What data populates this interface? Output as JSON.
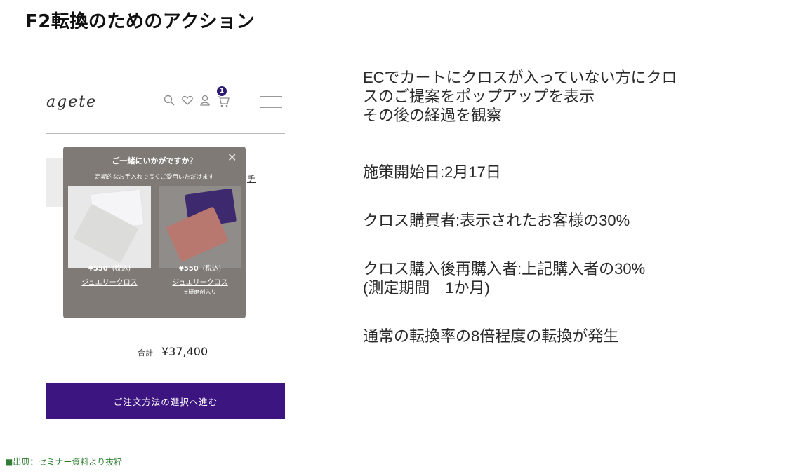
{
  "slide": {
    "title": "F2転換のためのアクション",
    "source": "■出典：セミナー資料より抜粋"
  },
  "site": {
    "logo": "agete",
    "cart_count": "1",
    "icons": [
      "search-icon",
      "heart-icon",
      "user-icon",
      "cart-icon",
      "menu-icon"
    ]
  },
  "popup": {
    "title": "ご一緒にいかがですか？",
    "subtitle": "定期的なお手入れで長くご愛用いただけます",
    "close": "✕",
    "products": [
      {
        "name": "ジュエリークロス",
        "note": "",
        "price": "¥550",
        "tax": "(税込)"
      },
      {
        "name": "ジュエリークロス",
        "note": "※研磨剤入り",
        "price": "¥550",
        "tax": "(税込)"
      }
    ]
  },
  "background": {
    "partial_text": "チ"
  },
  "cart": {
    "total_label": "合計",
    "total_value": "¥37,400",
    "cta_label": "ご注文方法の選択へ進む"
  },
  "notes": {
    "line1": "ECでカートにクロスが入っていない方にクロ\nスのご提案をポップアップを表示\nその後の経過を観察",
    "line2": "施策開始日:2月17日",
    "line3": "クロス購買者:表示されたお客様の30%",
    "line4": "クロス購入後再購入者:上記購入者の30%\n(測定期間　1か月)",
    "line5": "通常の転換率の8倍程度の転換が発生"
  },
  "colors": {
    "cta": "#3c1580",
    "popup": "#7f7a75",
    "badge": "#2b1a6e",
    "source": "#2e7d32"
  }
}
